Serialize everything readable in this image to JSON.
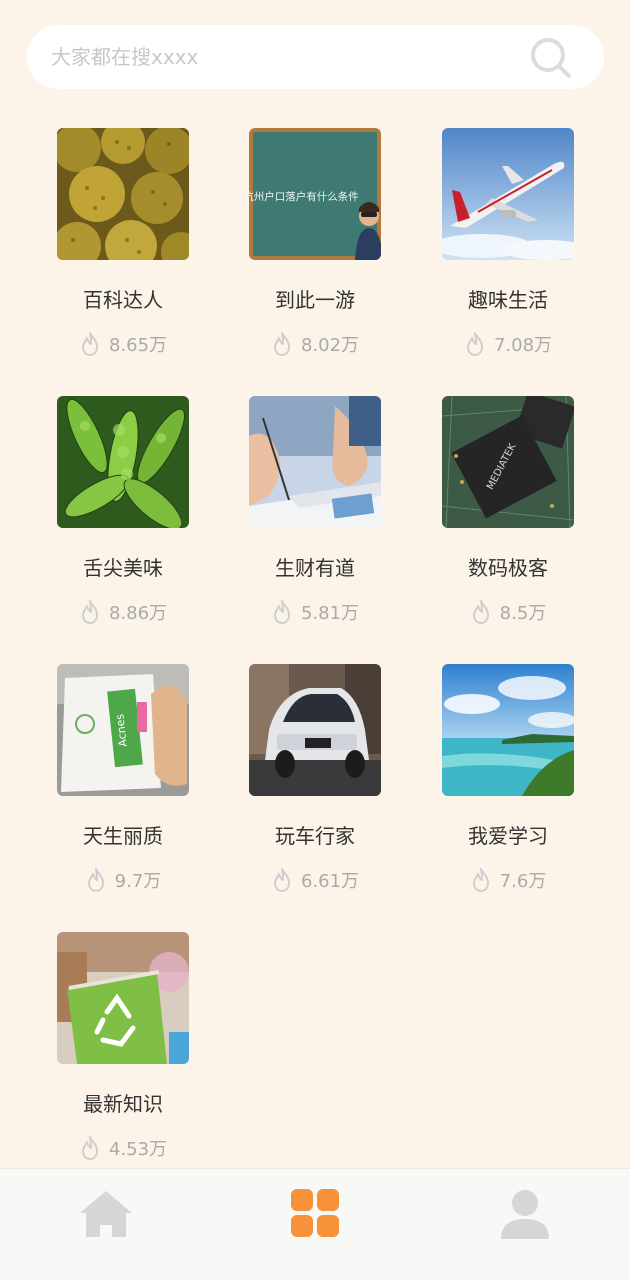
{
  "search": {
    "placeholder": "大家都在搜xxxx"
  },
  "categories": [
    {
      "title": "百科达人",
      "count": "8.65万",
      "image": "durian"
    },
    {
      "title": "到此一游",
      "count": "8.02万",
      "image": "chalkboard",
      "image_text": "杭州户口落户有什么条件"
    },
    {
      "title": "趣味生活",
      "count": "7.08万",
      "image": "airplane"
    },
    {
      "title": "舌尖美味",
      "count": "8.86万",
      "image": "edamame"
    },
    {
      "title": "生财有道",
      "count": "5.81万",
      "image": "writing-hands"
    },
    {
      "title": "数码极客",
      "count": "8.5万",
      "image": "chip",
      "image_text": "MEDIATEK"
    },
    {
      "title": "天生丽质",
      "count": "9.7万",
      "image": "product-bag",
      "image_text": "Acnes"
    },
    {
      "title": "玩车行家",
      "count": "6.61万",
      "image": "suv"
    },
    {
      "title": "我爱学习",
      "count": "7.6万",
      "image": "seascape"
    },
    {
      "title": "最新知识",
      "count": "4.53万",
      "image": "recycle-bag"
    }
  ],
  "tabbar": [
    {
      "name": "home",
      "icon": "home-icon",
      "active": false
    },
    {
      "name": "categories",
      "icon": "grid-icon",
      "active": true
    },
    {
      "name": "profile",
      "icon": "user-icon",
      "active": false
    }
  ],
  "colors": {
    "background": "#fcf4e8",
    "accent": "#f7913a",
    "inactive": "#d6d6d6",
    "muted_text": "#aaaaaa"
  }
}
